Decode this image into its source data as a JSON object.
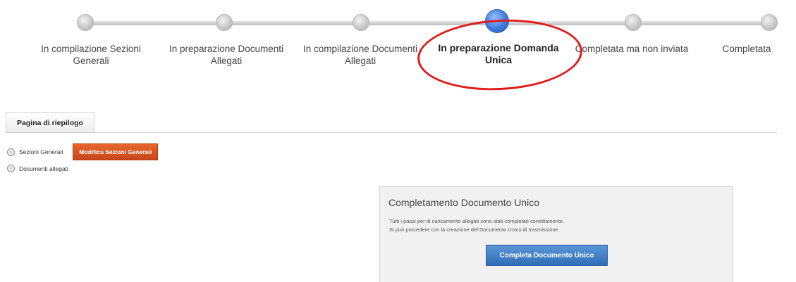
{
  "stepper": {
    "steps": [
      {
        "label_line1": "In compilazione Sezioni",
        "label_line2": "Generali"
      },
      {
        "label_line1": "In preparazione Documenti",
        "label_line2": "Allegati"
      },
      {
        "label_line1": "In compilazione Documenti",
        "label_line2": "Allegati"
      },
      {
        "label_line1": "In preparazione Domanda",
        "label_line2": "Unica"
      },
      {
        "label_line1": "Completata ma non inviata",
        "label_line2": ""
      },
      {
        "label_line1": "Completata",
        "label_line2": ""
      }
    ],
    "active_step": 4
  },
  "tabs": {
    "summary_label": "Pagina di riepilogo"
  },
  "sections": {
    "general_label": "Sezioni Generali",
    "edit_general_button": "Modifica Sezioni Generali",
    "attachments_label": "Documenti allegati"
  },
  "completion_panel": {
    "title": "Completamento Documento Unico",
    "text_line1": "Tutti i passi per di caricamento allegati sono stati completati correttamente.",
    "text_line2": "Si può procedere con la creazione del Documento Unico di trasmissione.",
    "button_label": "Completa Documento Unico"
  },
  "colors": {
    "active_step": "#3e7ad9",
    "highlight": "#e01b1b",
    "orange_button": "#c8461a",
    "blue_button": "#2f6fb8"
  }
}
